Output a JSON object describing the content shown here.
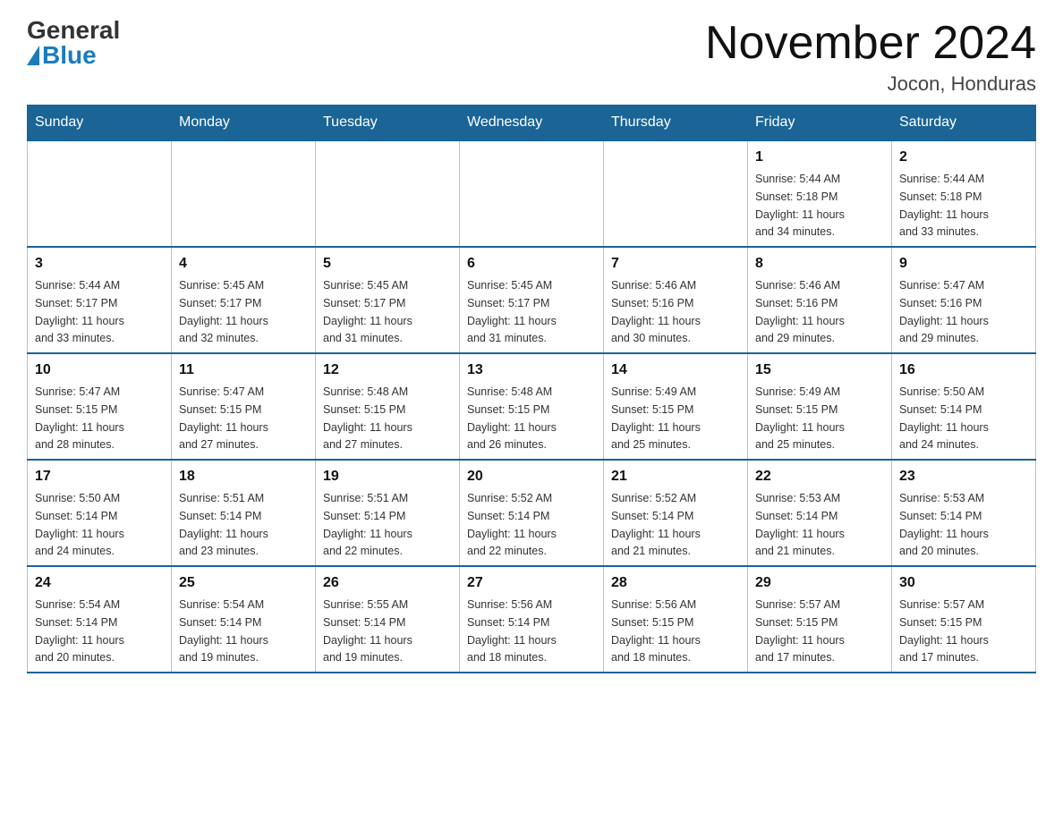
{
  "header": {
    "logo_general": "General",
    "logo_blue": "Blue",
    "month_title": "November 2024",
    "location": "Jocon, Honduras"
  },
  "days_of_week": [
    "Sunday",
    "Monday",
    "Tuesday",
    "Wednesday",
    "Thursday",
    "Friday",
    "Saturday"
  ],
  "weeks": [
    [
      {
        "day": "",
        "info": ""
      },
      {
        "day": "",
        "info": ""
      },
      {
        "day": "",
        "info": ""
      },
      {
        "day": "",
        "info": ""
      },
      {
        "day": "",
        "info": ""
      },
      {
        "day": "1",
        "info": "Sunrise: 5:44 AM\nSunset: 5:18 PM\nDaylight: 11 hours\nand 34 minutes."
      },
      {
        "day": "2",
        "info": "Sunrise: 5:44 AM\nSunset: 5:18 PM\nDaylight: 11 hours\nand 33 minutes."
      }
    ],
    [
      {
        "day": "3",
        "info": "Sunrise: 5:44 AM\nSunset: 5:17 PM\nDaylight: 11 hours\nand 33 minutes."
      },
      {
        "day": "4",
        "info": "Sunrise: 5:45 AM\nSunset: 5:17 PM\nDaylight: 11 hours\nand 32 minutes."
      },
      {
        "day": "5",
        "info": "Sunrise: 5:45 AM\nSunset: 5:17 PM\nDaylight: 11 hours\nand 31 minutes."
      },
      {
        "day": "6",
        "info": "Sunrise: 5:45 AM\nSunset: 5:17 PM\nDaylight: 11 hours\nand 31 minutes."
      },
      {
        "day": "7",
        "info": "Sunrise: 5:46 AM\nSunset: 5:16 PM\nDaylight: 11 hours\nand 30 minutes."
      },
      {
        "day": "8",
        "info": "Sunrise: 5:46 AM\nSunset: 5:16 PM\nDaylight: 11 hours\nand 29 minutes."
      },
      {
        "day": "9",
        "info": "Sunrise: 5:47 AM\nSunset: 5:16 PM\nDaylight: 11 hours\nand 29 minutes."
      }
    ],
    [
      {
        "day": "10",
        "info": "Sunrise: 5:47 AM\nSunset: 5:15 PM\nDaylight: 11 hours\nand 28 minutes."
      },
      {
        "day": "11",
        "info": "Sunrise: 5:47 AM\nSunset: 5:15 PM\nDaylight: 11 hours\nand 27 minutes."
      },
      {
        "day": "12",
        "info": "Sunrise: 5:48 AM\nSunset: 5:15 PM\nDaylight: 11 hours\nand 27 minutes."
      },
      {
        "day": "13",
        "info": "Sunrise: 5:48 AM\nSunset: 5:15 PM\nDaylight: 11 hours\nand 26 minutes."
      },
      {
        "day": "14",
        "info": "Sunrise: 5:49 AM\nSunset: 5:15 PM\nDaylight: 11 hours\nand 25 minutes."
      },
      {
        "day": "15",
        "info": "Sunrise: 5:49 AM\nSunset: 5:15 PM\nDaylight: 11 hours\nand 25 minutes."
      },
      {
        "day": "16",
        "info": "Sunrise: 5:50 AM\nSunset: 5:14 PM\nDaylight: 11 hours\nand 24 minutes."
      }
    ],
    [
      {
        "day": "17",
        "info": "Sunrise: 5:50 AM\nSunset: 5:14 PM\nDaylight: 11 hours\nand 24 minutes."
      },
      {
        "day": "18",
        "info": "Sunrise: 5:51 AM\nSunset: 5:14 PM\nDaylight: 11 hours\nand 23 minutes."
      },
      {
        "day": "19",
        "info": "Sunrise: 5:51 AM\nSunset: 5:14 PM\nDaylight: 11 hours\nand 22 minutes."
      },
      {
        "day": "20",
        "info": "Sunrise: 5:52 AM\nSunset: 5:14 PM\nDaylight: 11 hours\nand 22 minutes."
      },
      {
        "day": "21",
        "info": "Sunrise: 5:52 AM\nSunset: 5:14 PM\nDaylight: 11 hours\nand 21 minutes."
      },
      {
        "day": "22",
        "info": "Sunrise: 5:53 AM\nSunset: 5:14 PM\nDaylight: 11 hours\nand 21 minutes."
      },
      {
        "day": "23",
        "info": "Sunrise: 5:53 AM\nSunset: 5:14 PM\nDaylight: 11 hours\nand 20 minutes."
      }
    ],
    [
      {
        "day": "24",
        "info": "Sunrise: 5:54 AM\nSunset: 5:14 PM\nDaylight: 11 hours\nand 20 minutes."
      },
      {
        "day": "25",
        "info": "Sunrise: 5:54 AM\nSunset: 5:14 PM\nDaylight: 11 hours\nand 19 minutes."
      },
      {
        "day": "26",
        "info": "Sunrise: 5:55 AM\nSunset: 5:14 PM\nDaylight: 11 hours\nand 19 minutes."
      },
      {
        "day": "27",
        "info": "Sunrise: 5:56 AM\nSunset: 5:14 PM\nDaylight: 11 hours\nand 18 minutes."
      },
      {
        "day": "28",
        "info": "Sunrise: 5:56 AM\nSunset: 5:15 PM\nDaylight: 11 hours\nand 18 minutes."
      },
      {
        "day": "29",
        "info": "Sunrise: 5:57 AM\nSunset: 5:15 PM\nDaylight: 11 hours\nand 17 minutes."
      },
      {
        "day": "30",
        "info": "Sunrise: 5:57 AM\nSunset: 5:15 PM\nDaylight: 11 hours\nand 17 minutes."
      }
    ]
  ]
}
